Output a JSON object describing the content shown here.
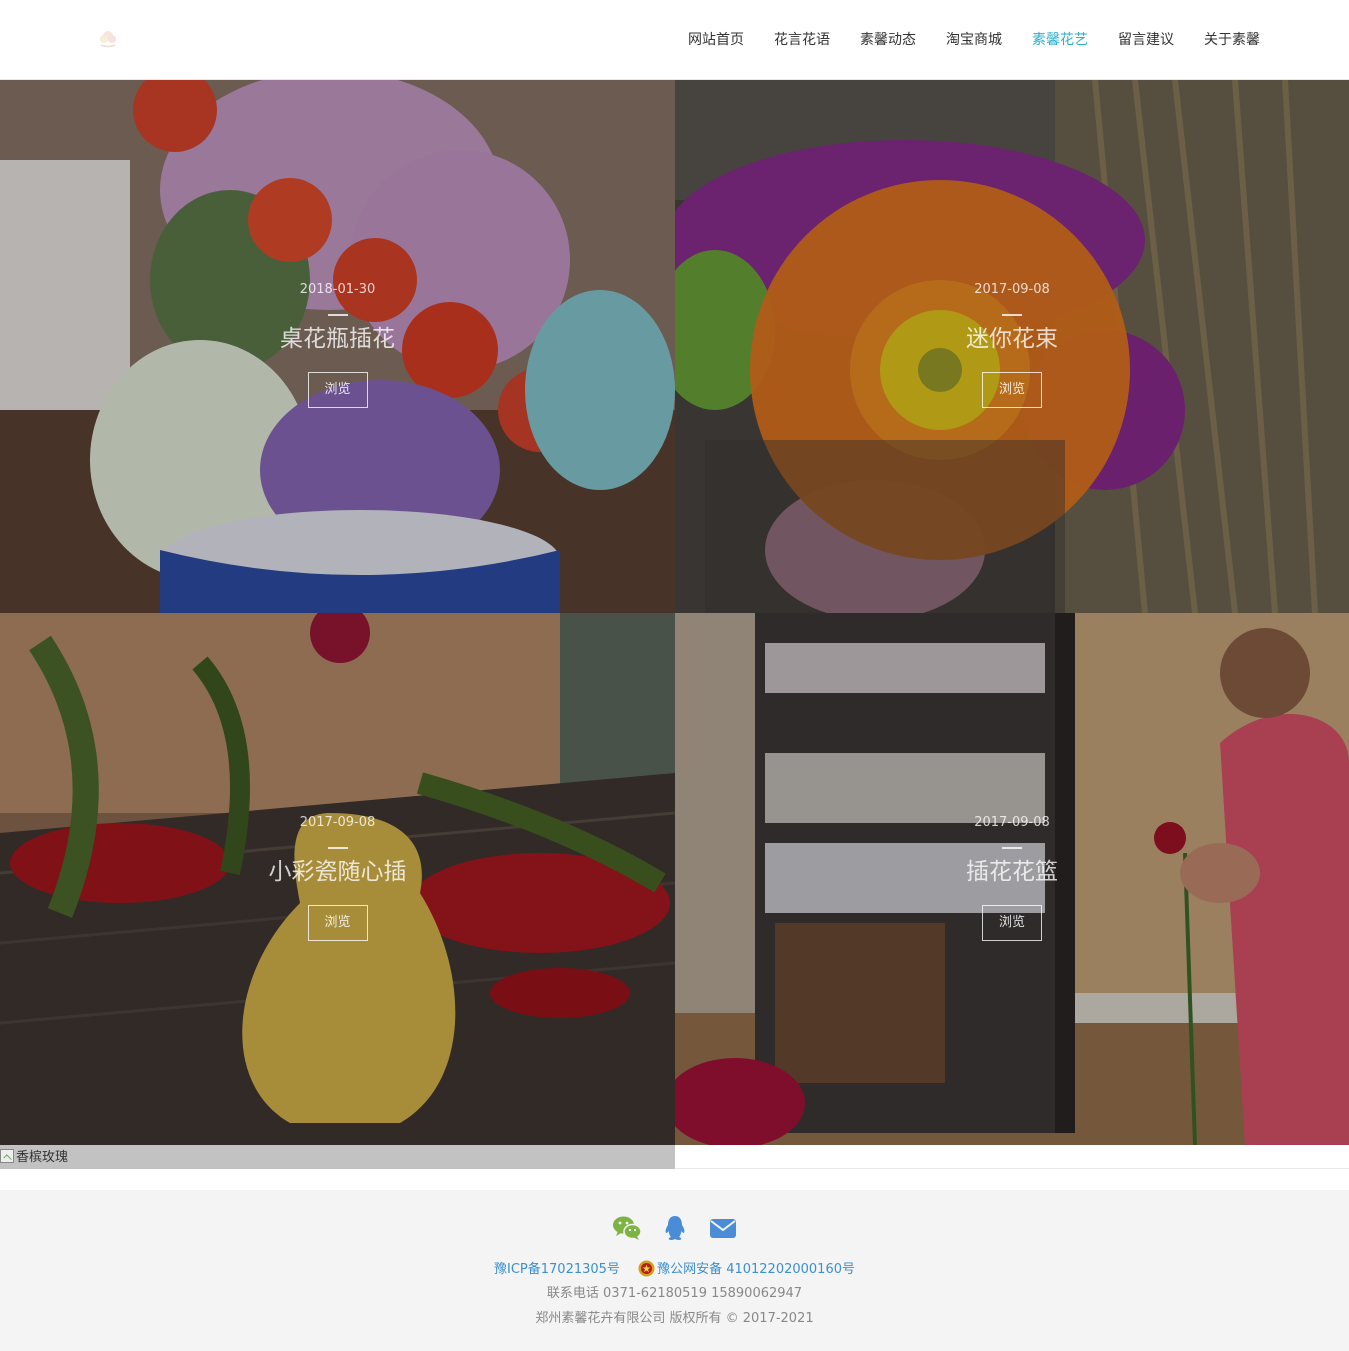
{
  "header": {
    "logo_icon": "flower-logo-icon",
    "nav": [
      {
        "label": "网站首页",
        "active": false
      },
      {
        "label": "花言花语",
        "active": false
      },
      {
        "label": "素馨动态",
        "active": false
      },
      {
        "label": "淘宝商城",
        "active": false
      },
      {
        "label": "素馨花艺",
        "active": true
      },
      {
        "label": "留言建议",
        "active": false
      },
      {
        "label": "关于素馨",
        "active": false
      }
    ],
    "accent_color": "#2eaecb"
  },
  "gallery": {
    "items": [
      {
        "date": "2018-01-30",
        "title": "桌花瓶插花",
        "button": "浏览"
      },
      {
        "date": "2017-09-08",
        "title": "迷你花束",
        "button": "浏览"
      },
      {
        "date": "2017-09-08",
        "title": "小彩瓷随心插",
        "button": "浏览"
      },
      {
        "date": "2017-09-08",
        "title": "插花花篮",
        "button": "浏览"
      }
    ],
    "broken_image_alt": "香槟玫瑰"
  },
  "footer": {
    "icons": [
      "wechat-icon",
      "qq-icon",
      "email-icon"
    ],
    "icp": "豫ICP备17021305号",
    "police": "豫公网安备 41012202000160号",
    "contact": "联系电话 0371-62180519 15890062947",
    "copyright": "郑州素馨花卉有限公司 版权所有 © 2017-2021",
    "link_color": "#3c8fd1"
  }
}
